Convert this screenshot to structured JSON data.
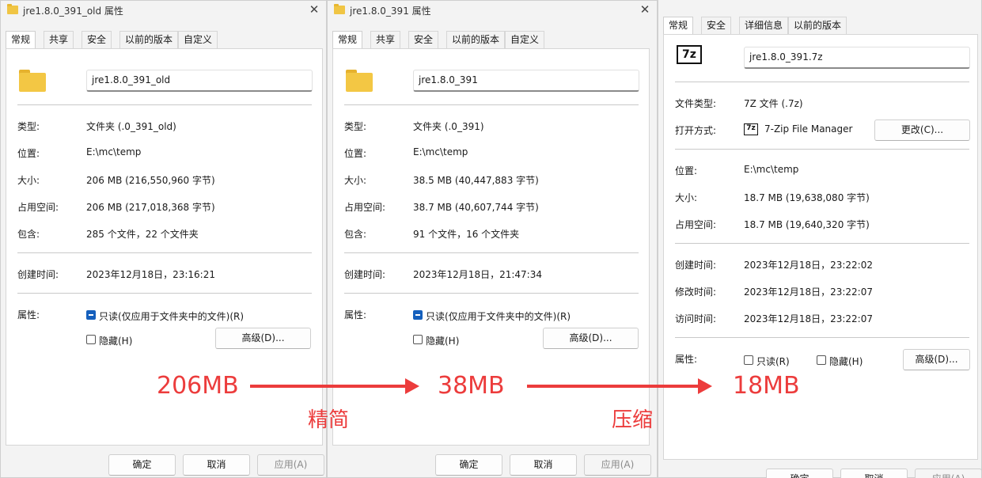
{
  "dialogs": [
    {
      "title": "jre1.8.0_391_old 属性",
      "tabs": [
        "常规",
        "共享",
        "安全",
        "以前的版本",
        "自定义"
      ],
      "name": "jre1.8.0_391_old",
      "rows": [
        {
          "label": "类型:",
          "value": "文件夹 (.0_391_old)"
        },
        {
          "label": "位置:",
          "value": "E:\\mc\\temp"
        },
        {
          "label": "大小:",
          "value": "206 MB (216,550,960 字节)"
        },
        {
          "label": "占用空间:",
          "value": "206 MB (217,018,368 字节)"
        },
        {
          "label": "包含:",
          "value": "285 个文件，22 个文件夹"
        }
      ],
      "created": {
        "label": "创建时间:",
        "value": "2023年12月18日，23:16:21"
      },
      "attr_label": "属性:",
      "readonly": "只读(仅应用于文件夹中的文件)(R)",
      "hidden": "隐藏(H)",
      "advanced": "高级(D)...",
      "ok": "确定",
      "cancel": "取消",
      "apply": "应用(A)"
    },
    {
      "title": "jre1.8.0_391 属性",
      "tabs": [
        "常规",
        "共享",
        "安全",
        "以前的版本",
        "自定义"
      ],
      "name": "jre1.8.0_391",
      "rows": [
        {
          "label": "类型:",
          "value": "文件夹 (.0_391)"
        },
        {
          "label": "位置:",
          "value": "E:\\mc\\temp"
        },
        {
          "label": "大小:",
          "value": "38.5 MB (40,447,883 字节)"
        },
        {
          "label": "占用空间:",
          "value": "38.7 MB (40,607,744 字节)"
        },
        {
          "label": "包含:",
          "value": "91 个文件，16 个文件夹"
        }
      ],
      "created": {
        "label": "创建时间:",
        "value": "2023年12月18日，21:47:34"
      },
      "attr_label": "属性:",
      "readonly": "只读(仅应用于文件夹中的文件)(R)",
      "hidden": "隐藏(H)",
      "advanced": "高级(D)...",
      "ok": "确定",
      "cancel": "取消",
      "apply": "应用(A)"
    },
    {
      "tabs": [
        "常规",
        "安全",
        "详细信息",
        "以前的版本"
      ],
      "icon_text": "7z",
      "name": "jre1.8.0_391.7z",
      "type": {
        "label": "文件类型:",
        "value": "7Z 文件 (.7z)"
      },
      "opens_with": {
        "label": "打开方式:",
        "value": "7-Zip File Manager",
        "change": "更改(C)..."
      },
      "rows": [
        {
          "label": "位置:",
          "value": "E:\\mc\\temp"
        },
        {
          "label": "大小:",
          "value": "18.7 MB (19,638,080 字节)"
        },
        {
          "label": "占用空间:",
          "value": "18.7 MB (19,640,320 字节)"
        }
      ],
      "times": [
        {
          "label": "创建时间:",
          "value": "2023年12月18日，23:22:02"
        },
        {
          "label": "修改时间:",
          "value": "2023年12月18日，23:22:07"
        },
        {
          "label": "访问时间:",
          "value": "2023年12月18日，23:22:07"
        }
      ],
      "attr_label": "属性:",
      "readonly": "只读(R)",
      "hidden": "隐藏(H)",
      "advanced": "高级(D)...",
      "ok": "确定",
      "cancel": "取消",
      "apply": "应用(A)"
    }
  ],
  "annotations": {
    "size1": "206MB",
    "size2": "38MB",
    "size3": "18MB",
    "step1": "精简",
    "step2": "压缩"
  },
  "colors": {
    "accent": "#1560bd",
    "annotation": "#ec3c3c",
    "folder": "#f3c744"
  }
}
